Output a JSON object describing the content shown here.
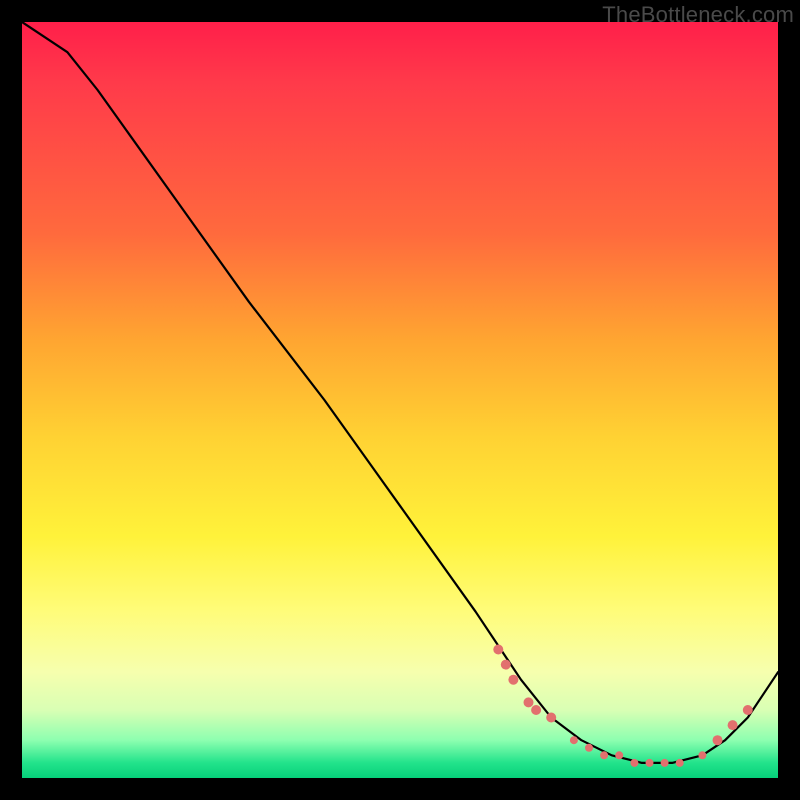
{
  "watermark": "TheBottleneck.com",
  "chart_data": {
    "type": "line",
    "title": "",
    "xlabel": "",
    "ylabel": "",
    "xlim": [
      0,
      100
    ],
    "ylim": [
      0,
      100
    ],
    "series": [
      {
        "name": "curve",
        "x": [
          0,
          6,
          10,
          20,
          30,
          40,
          50,
          60,
          66,
          70,
          74,
          78,
          82,
          86,
          90,
          93,
          96,
          100
        ],
        "y": [
          100,
          96,
          91,
          77,
          63,
          50,
          36,
          22,
          13,
          8,
          5,
          3,
          2,
          2,
          3,
          5,
          8,
          14
        ]
      }
    ],
    "markers": {
      "name": "highlight-dots",
      "x": [
        63,
        64,
        65,
        67,
        68,
        70,
        73,
        75,
        77,
        79,
        81,
        83,
        85,
        87,
        90,
        92,
        94,
        96
      ],
      "y": [
        17,
        15,
        13,
        10,
        9,
        8,
        5,
        4,
        3,
        3,
        2,
        2,
        2,
        2,
        3,
        5,
        7,
        9
      ],
      "r": [
        5,
        5,
        5,
        5,
        5,
        5,
        4,
        4,
        4,
        4,
        4,
        4,
        4,
        4,
        4,
        5,
        5,
        5
      ]
    }
  }
}
